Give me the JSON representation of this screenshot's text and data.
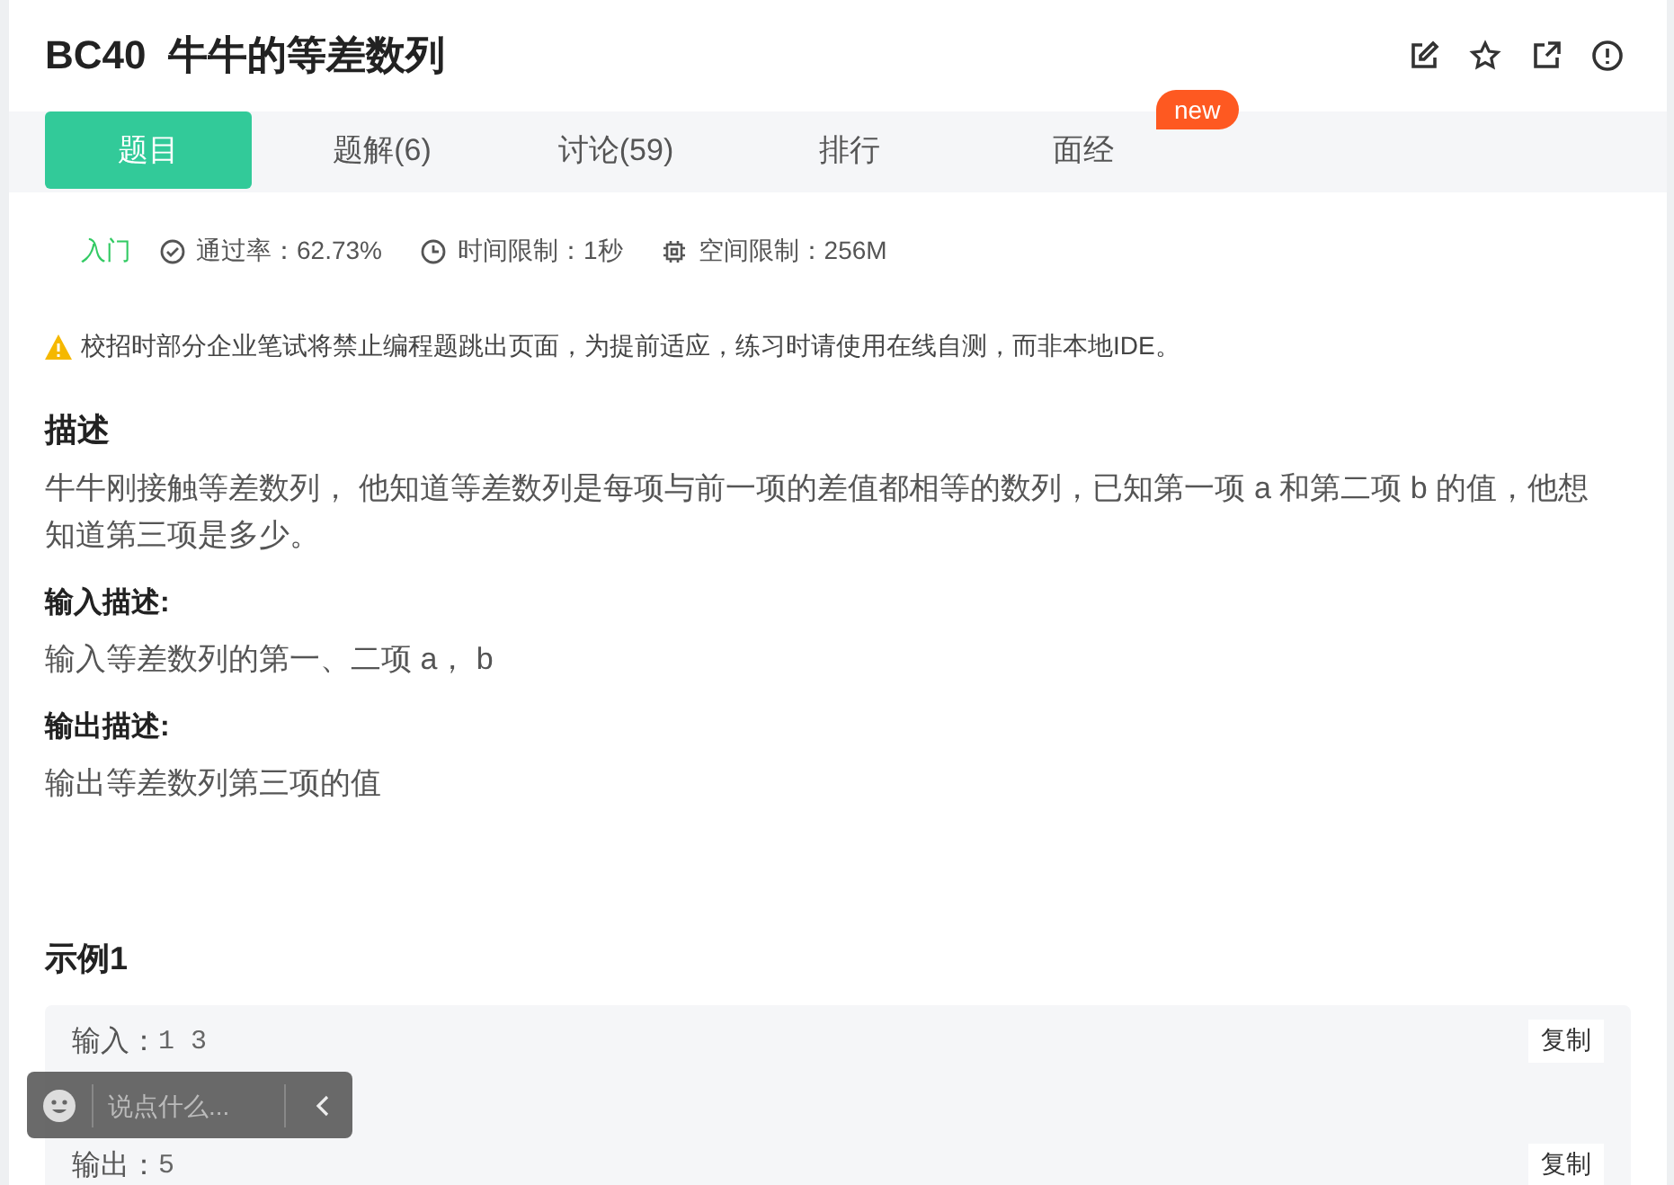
{
  "title": "BC40  牛牛的等差数列",
  "tabs": [
    {
      "label": "题目",
      "selected": true
    },
    {
      "label": "题解(6)",
      "selected": false
    },
    {
      "label": "讨论(59)",
      "selected": false
    },
    {
      "label": "排行",
      "selected": false
    },
    {
      "label": "面经",
      "selected": false,
      "badge": "new"
    }
  ],
  "meta": {
    "difficulty": "入门",
    "pass_rate": "通过率：62.73%",
    "time_limit": "时间限制：1秒",
    "space_limit": "空间限制：256M"
  },
  "notice": "校招时部分企业笔试将禁止编程题跳出页面，为提前适应，练习时请使用在线自测，而非本地IDE。",
  "sections": [
    {
      "heading": "描述",
      "body": "牛牛刚接触等差数列， 他知道等差数列是每项与前一项的差值都相等的数列，已知第一项 a 和第二项 b 的值，他想知道第三项是多少。"
    },
    {
      "heading": "输入描述:",
      "body": "输入等差数列的第一、二项 a， b"
    },
    {
      "heading": "输出描述:",
      "body": "输出等差数列第三项的值"
    }
  ],
  "example": {
    "heading": "示例1",
    "lines": [
      {
        "label": "输入：",
        "value": "1 3",
        "copy": "复制"
      },
      {
        "label": "输出：",
        "value": "5",
        "copy": "复制"
      }
    ]
  },
  "chat": {
    "placeholder": "说点什么..."
  }
}
